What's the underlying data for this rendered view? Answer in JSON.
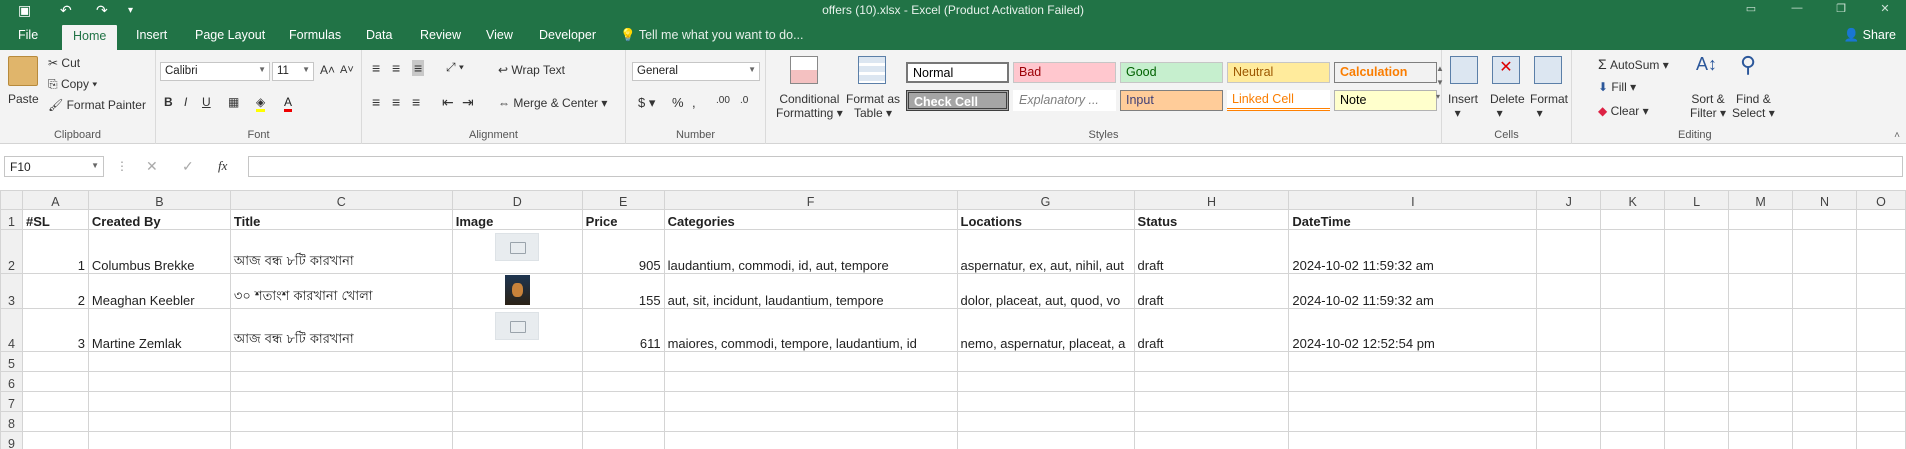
{
  "window": {
    "title": "offers (10).xlsx - Excel (Product Activation Failed)"
  },
  "tabs": [
    "File",
    "Home",
    "Insert",
    "Page Layout",
    "Formulas",
    "Data",
    "Review",
    "View",
    "Developer"
  ],
  "tell_me": "Tell me what you want to do...",
  "share": "Share",
  "clipboard": {
    "paste": "Paste",
    "cut": "Cut",
    "copy": "Copy",
    "format_painter": "Format Painter",
    "label": "Clipboard"
  },
  "font": {
    "name": "Calibri",
    "size": "11",
    "label": "Font"
  },
  "alignment": {
    "wrap": "Wrap Text",
    "merge": "Merge & Center",
    "label": "Alignment"
  },
  "number": {
    "format": "General",
    "label": "Number"
  },
  "styles": {
    "cond1": "Conditional",
    "cond2": "Formatting",
    "fmt1": "Format as",
    "fmt2": "Table",
    "label": "Styles",
    "cells": [
      "Normal",
      "Bad",
      "Good",
      "Neutral",
      "Calculation",
      "Check Cell",
      "Explanatory ...",
      "Input",
      "Linked Cell",
      "Note"
    ]
  },
  "cells": {
    "insert": "Insert",
    "delete": "Delete",
    "format": "Format",
    "label": "Cells"
  },
  "editing": {
    "autosum": "AutoSum",
    "fill": "Fill",
    "clear": "Clear",
    "sort1": "Sort &",
    "sort2": "Filter",
    "find1": "Find &",
    "find2": "Select",
    "label": "Editing"
  },
  "formula_bar": {
    "name_box": "F10",
    "content": ""
  },
  "columns": [
    "A",
    "B",
    "C",
    "D",
    "E",
    "F",
    "G",
    "H",
    "I",
    "J",
    "K",
    "L",
    "M",
    "N",
    "O"
  ],
  "headers": [
    "#SL",
    "Created By",
    "Title",
    "Image",
    "Price",
    "Categories",
    "Locations",
    "Status",
    "DateTime"
  ],
  "rows": [
    {
      "sl": "1",
      "by": "Columbus Brekke",
      "title": "আজ বন্ধ ৮টি কারখানা",
      "price": "905",
      "cats": "laudantium, commodi, id, aut, tempore",
      "locs": "aspernatur, ex, aut, nihil, aut",
      "status": "draft",
      "dt": "2024-10-02 11:59:32 am"
    },
    {
      "sl": "2",
      "by": "Meaghan Keebler",
      "title": "৩০ শতাংশ কারখানা খোলা",
      "price": "155",
      "cats": "aut, sit, incidunt, laudantium, tempore",
      "locs": "dolor, placeat, aut, quod, vo",
      "status": "draft",
      "dt": "2024-10-02 11:59:32 am"
    },
    {
      "sl": "3",
      "by": "Martine Zemlak",
      "title": "আজ বন্ধ ৮টি কারখানা",
      "price": "611",
      "cats": "maiores, commodi, tempore, laudantium, id",
      "locs": "nemo, aspernatur, placeat, a",
      "status": "draft",
      "dt": "2024-10-02 12:52:54 pm"
    }
  ],
  "row_numbers": [
    "1",
    "2",
    "3",
    "4",
    "5",
    "6",
    "7",
    "8",
    "9"
  ]
}
